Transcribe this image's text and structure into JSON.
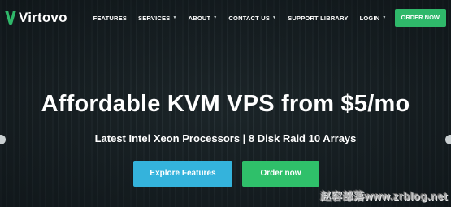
{
  "brand": {
    "name": "Virtovo",
    "accent_color": "#2fb86a",
    "logo_icon": "v-logo-icon"
  },
  "nav": {
    "items": [
      {
        "label": "FEATURES",
        "has_dropdown": false
      },
      {
        "label": "SERVICES",
        "has_dropdown": true
      },
      {
        "label": "ABOUT",
        "has_dropdown": true
      },
      {
        "label": "CONTACT US",
        "has_dropdown": true
      },
      {
        "label": "SUPPORT LIBRARY",
        "has_dropdown": false
      },
      {
        "label": "LOGIN",
        "has_dropdown": true
      }
    ],
    "order_button": "ORDER NOW",
    "dropdown_icon": "caret-down-icon"
  },
  "hero": {
    "headline": "Affordable KVM VPS from $5/mo",
    "subline": "Latest Intel Xeon Processors | 8 Disk Raid 10 Arrays",
    "primary_cta": "Explore Features",
    "secondary_cta": "Order now",
    "primary_cta_color": "#34b3dc",
    "secondary_cta_color": "#2fc06a"
  },
  "watermark": {
    "text": "赵容部落www.zrblog.net"
  }
}
